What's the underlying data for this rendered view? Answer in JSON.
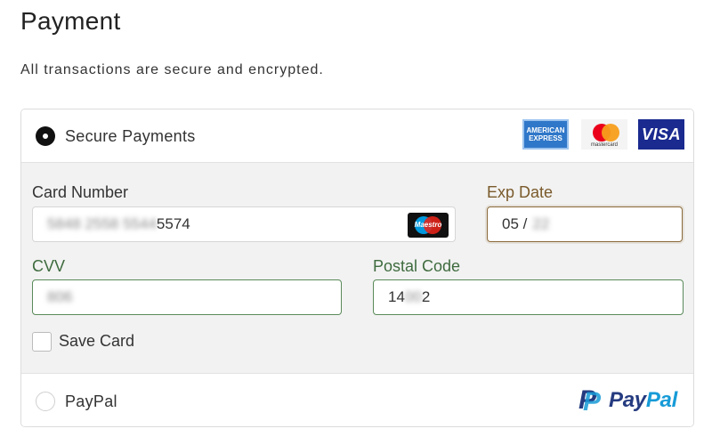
{
  "page": {
    "title": "Payment",
    "subtitle": "All transactions are secure and encrypted."
  },
  "secure_option": {
    "label": "Secure Payments",
    "selected": true,
    "card_logos": [
      {
        "name": "amex",
        "text_line1": "AMERICAN",
        "text_line2": "EXPRESS"
      },
      {
        "name": "mastercard",
        "text": "mastercard"
      },
      {
        "name": "visa",
        "text": "VISA"
      }
    ]
  },
  "form": {
    "card_number": {
      "label": "Card Number",
      "value_hidden": "5848 2558 5544",
      "value_visible": "5574",
      "brand": "Maestro"
    },
    "exp_date": {
      "label": "Exp Date",
      "value_visible": "05 /",
      "value_hidden": "22"
    },
    "cvv": {
      "label": "CVV",
      "value_hidden": "806"
    },
    "postal_code": {
      "label": "Postal Code",
      "value_visible_prefix": "14",
      "value_hidden": "00",
      "value_visible_suffix": "2"
    },
    "save_card": {
      "label": "Save Card",
      "checked": false
    }
  },
  "paypal_option": {
    "label": "PayPal",
    "selected": false,
    "logo_pay": "Pay",
    "logo_pal": "Pal",
    "logo_mark": "P"
  },
  "colors": {
    "accent_green": "#3e6b3e",
    "accent_brown": "#7a5a2b",
    "paypal_dark": "#253b80",
    "paypal_light": "#179bd7"
  }
}
